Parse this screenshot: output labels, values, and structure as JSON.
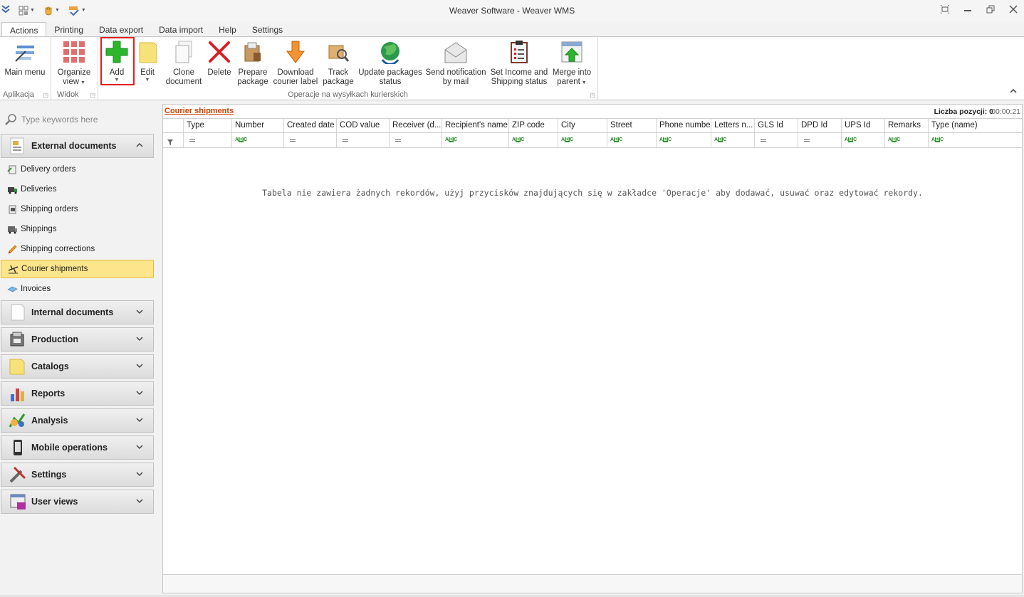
{
  "window": {
    "title": "Weaver Software - Weaver WMS"
  },
  "tabs": [
    {
      "label": "Actions",
      "active": true
    },
    {
      "label": "Printing"
    },
    {
      "label": "Data export"
    },
    {
      "label": "Data import"
    },
    {
      "label": "Help"
    },
    {
      "label": "Settings"
    }
  ],
  "ribbon": {
    "groups": {
      "aplikacja": "Aplikacja",
      "widok": "Widok",
      "operacje": "Operacje na wysyłkach kurierskich"
    },
    "buttons": {
      "main_menu": "Main menu",
      "organize_view_1": "Organize",
      "organize_view_2": "view",
      "add": "Add",
      "edit": "Edit",
      "clone_1": "Clone",
      "clone_2": "document",
      "delete": "Delete",
      "prepare_1": "Prepare",
      "prepare_2": "package",
      "download_1": "Download",
      "download_2": "courier label",
      "track_1": "Track",
      "track_2": "package",
      "update_1": "Update packages",
      "update_2": "status",
      "notify_1": "Send notification",
      "notify_2": "by mail",
      "income_1": "Set Income and",
      "income_2": "Shipping status",
      "merge_1": "Merge into",
      "merge_2": "parent"
    }
  },
  "sidebar": {
    "search_placeholder": "Type keywords here",
    "sections": {
      "external": "External documents",
      "internal": "Internal documents",
      "production": "Production",
      "catalogs": "Catalogs",
      "reports": "Reports",
      "analysis": "Analysis",
      "mobile": "Mobile operations",
      "settings": "Settings",
      "user_views": "User views"
    },
    "items": {
      "delivery_orders": "Delivery orders",
      "deliveries": "Deliveries",
      "shipping_orders": "Shipping orders",
      "shippings": "Shippings",
      "shipping_corrections": "Shipping corrections",
      "courier_shipments": "Courier shipments",
      "invoices": "Invoices"
    },
    "selected": "Courier shipments"
  },
  "grid": {
    "title": "Courier shipments",
    "count_label": "Liczba pozycji: 0",
    "elapsed": "00:00:21",
    "columns": {
      "c1": "Type",
      "c2": "Number",
      "c3": "Created date",
      "c4": "COD value",
      "c5": "Receiver (d...",
      "c6": "Recipient's name",
      "c7": "ZIP code",
      "c8": "City",
      "c9": "Street",
      "c10": "Phone number",
      "c11": "Letters n...",
      "c12": "GLS Id",
      "c13": "DPD Id",
      "c14": "UPS Id",
      "c15": "Remarks",
      "c16": "Type (name)"
    },
    "empty_message": "Tabela nie zawiera żadnych rekordów, użyj przycisków znajdujących się w zakładce 'Operacje' aby dodawać, usuwać oraz edytować rekordy.",
    "abc_label": "ABC"
  },
  "colors": {
    "accent_selected": "#fde58b",
    "title_link": "#d04000",
    "highlight_box": "#e02020"
  }
}
